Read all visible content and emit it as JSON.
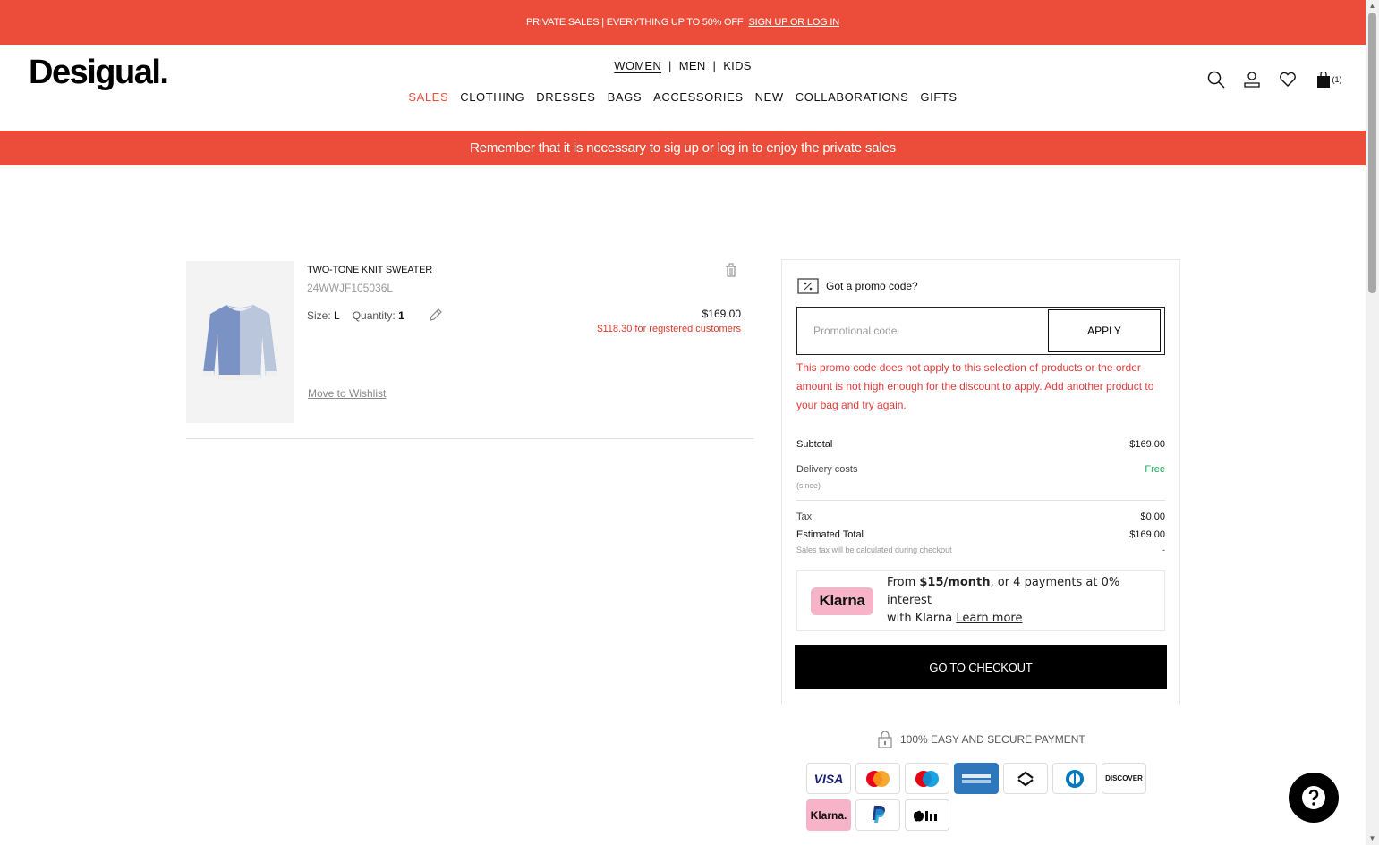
{
  "top_banner": {
    "text": "PRIVATE SALES | EVERYTHING UP TO 50% OFF",
    "link": "SIGN UP OR LOG IN"
  },
  "header": {
    "logo": "Desigual.",
    "genders": [
      "WOMEN",
      "MEN",
      "KIDS"
    ],
    "categories": [
      "SALES",
      "CLOTHING",
      "DRESSES",
      "BAGS",
      "ACCESSORIES",
      "NEW",
      "COLLABORATIONS",
      "GIFTS"
    ],
    "bag_count": "(1)"
  },
  "notice": "Remember that it is necessary to sig up or log in to enjoy the private sales",
  "product": {
    "name": "TWO-TONE KNIT SWEATER",
    "ref": "24WWJF105036L",
    "size_label": "Size:",
    "size_value": "L",
    "qty_label": "Quantity:",
    "qty_value": "1",
    "price": "$169.00",
    "member_price": "$118.30 for registered customers",
    "move_wishlist": "Move to Wishlist"
  },
  "summary": {
    "promo_title": "Got a promo code?",
    "promo_placeholder": "Promotional code",
    "apply_label": "APPLY",
    "promo_error": "This promo code does not apply to this selection of products or the order amount is not high enough for the discount to apply. Add another product to your bag and try again.",
    "subtotal_label": "Subtotal",
    "subtotal_value": "$169.00",
    "delivery_label": "Delivery costs",
    "delivery_value": "Free",
    "delivery_sub": "(since)",
    "tax_label": "Tax",
    "tax_value": "$0.00",
    "total_label": "Estimated Total",
    "total_value": "$169.00",
    "total_sub": "Sales tax will be calculated during checkout",
    "total_sub_value": "-",
    "klarna_badge": "Klarna",
    "klarna_pre": "From ",
    "klarna_amount": "$15/month",
    "klarna_post": ", or 4 payments at 0% interest",
    "klarna_line2": "with Klarna ",
    "klarna_link": "Learn more",
    "checkout_label": "GO TO CHECKOUT"
  },
  "secure_payment": "100% EASY AND SECURE PAYMENT",
  "payment_methods": [
    "VISA",
    "Mastercard",
    "Maestro",
    "American Express",
    "Afterpay",
    "Diners Club",
    "DISCOVER",
    "Klarna.",
    "PayPal",
    "Apple Pay"
  ],
  "colors": {
    "brand_red": "#ec4d3a",
    "error_red": "#e23a3a",
    "free_green": "#1fa45a",
    "klarna_pink": "#f7b3c8"
  }
}
